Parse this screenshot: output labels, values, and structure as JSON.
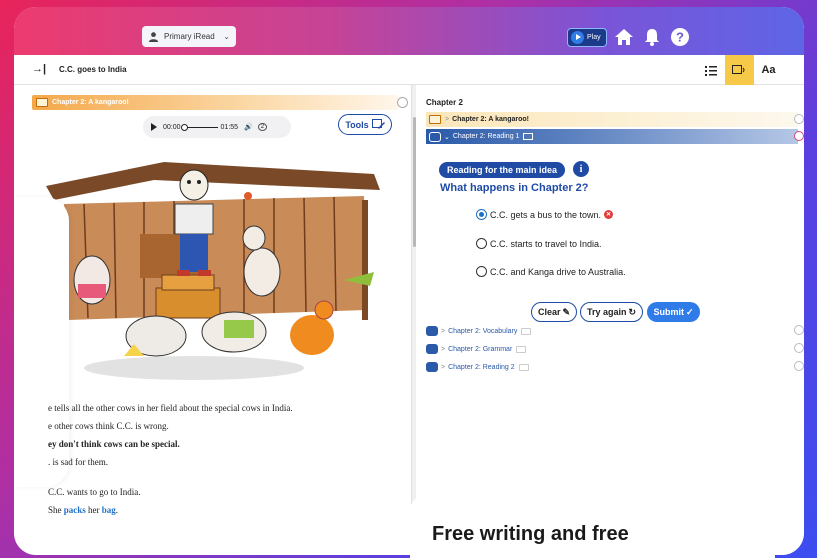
{
  "header": {
    "user_selector": "Primary iRead",
    "play_label": "Play"
  },
  "subbar": {
    "book_title": "C.C. goes to India",
    "text_size_label": "Aa"
  },
  "left": {
    "chapter_banner": "Chapter 2: A kangaroo!",
    "audio": {
      "current": "00:00",
      "duration": "01:55"
    },
    "tools_label": "Tools",
    "story_lines": [
      "e tells all the other cows in her field about the special cows in India.",
      "e other cows think C.C. is wrong.",
      "ey don't think cows can be special.",
      ". is sad for them."
    ],
    "story_line_5": "C.C. wants to go to India.",
    "story_line_6_a": "She ",
    "story_line_6_kw1": "packs",
    "story_line_6_b": " her ",
    "story_line_6_kw2": "bag",
    "story_line_6_c": "."
  },
  "right": {
    "section_title": "Chapter 2",
    "row1": "Chapter 2: A kangaroo!",
    "row2": "Chapter 2: Reading 1",
    "skill_label": "Reading for the main idea",
    "info_label": "i",
    "question": "What happens in Chapter 2?",
    "options": [
      "C.C. gets a bus to the town.",
      "C.C. starts to travel to India.",
      "C.C. and Kanga drive to Australia."
    ],
    "buttons": {
      "clear": "Clear",
      "try_again": "Try again",
      "submit": "Submit"
    },
    "sub_rows": [
      "Chapter 2: Vocabulary",
      "Chapter 2: Grammar",
      "Chapter 2: Reading 2"
    ]
  },
  "promo": "Free writing and free"
}
